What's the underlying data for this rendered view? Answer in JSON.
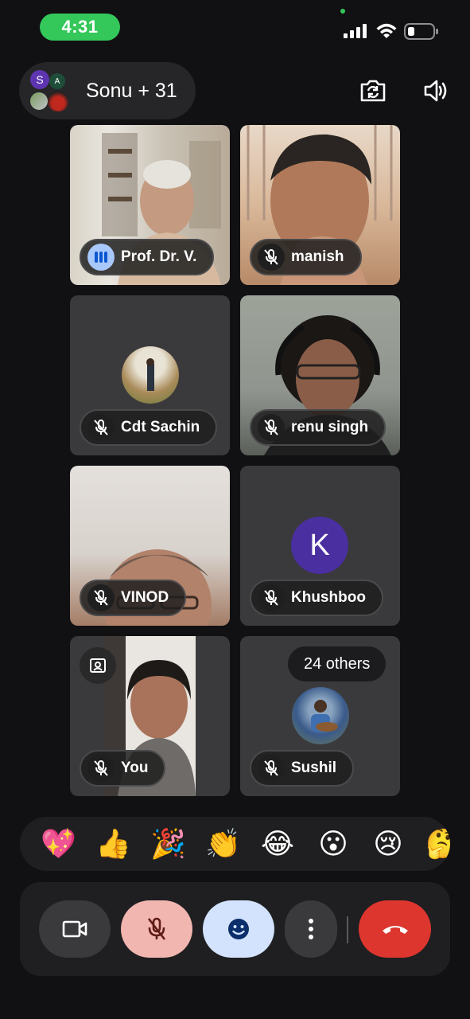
{
  "status_bar": {
    "time": "4:31"
  },
  "header": {
    "call_title": "Sonu + 31",
    "avatar_initials": [
      "S",
      "A"
    ]
  },
  "tiles": [
    {
      "name": "Prof. Dr. V.",
      "state": "speaking"
    },
    {
      "name": "manish",
      "state": "muted"
    },
    {
      "name": "Cdt Sachin",
      "state": "muted"
    },
    {
      "name": "renu singh",
      "state": "muted"
    },
    {
      "name": "VINOD",
      "state": "muted"
    },
    {
      "name": "Khushboo",
      "state": "muted",
      "initial": "K"
    },
    {
      "name": "You",
      "state": "muted"
    },
    {
      "name": "Sushil",
      "state": "muted",
      "others_label": "24 others"
    }
  ],
  "reactions": [
    "💖",
    "👍",
    "🎉",
    "👏",
    "😂",
    "😮",
    "😢",
    "🤔"
  ],
  "colors": {
    "speaking": "#a8c7fa",
    "mic_off": "#f2b6b0",
    "emoji_active": "#d3e3fd",
    "end_call": "#dc362e",
    "status_green": "#34c759",
    "avatar_k": "#4a2fa0"
  },
  "controls": [
    "video-icon",
    "mic-off-icon",
    "emoji-icon",
    "more-vert-icon",
    "call-end-icon"
  ]
}
